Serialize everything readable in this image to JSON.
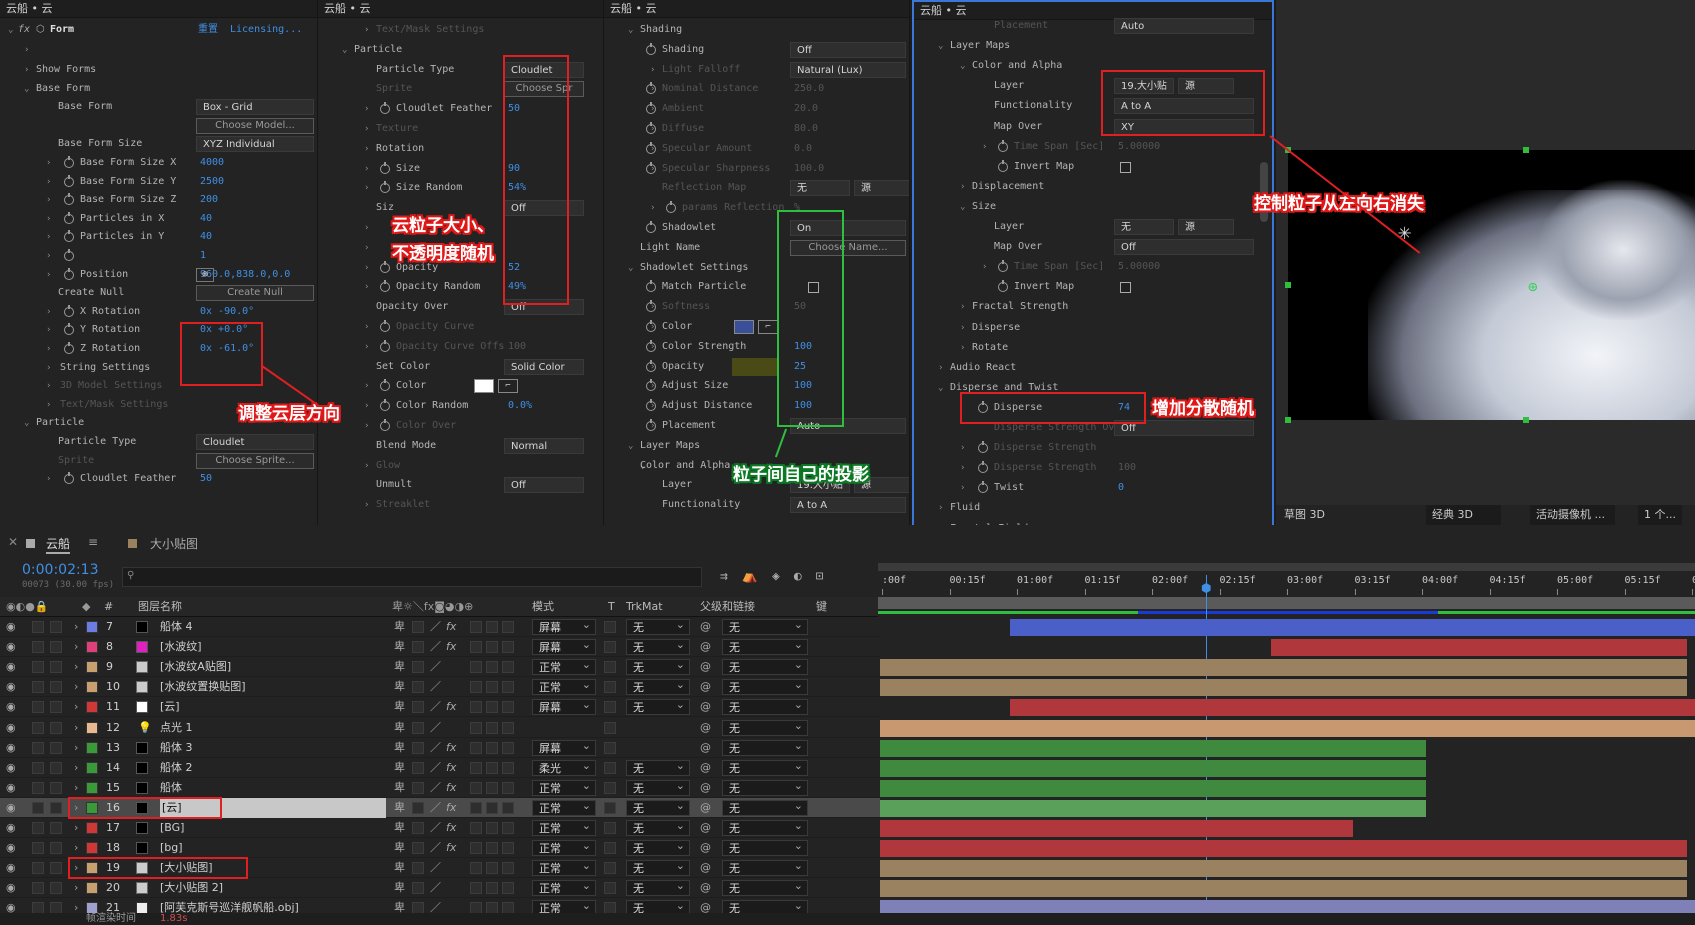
{
  "colors": {
    "accent": "#3f8fe5",
    "annotation_red": "#e02020",
    "annotation_green": "#2fbf3f",
    "selected_panel_border": "#3a78d8"
  },
  "panel1": {
    "title": "云船 • 云",
    "fx_label": "fx",
    "effect_name": "Form",
    "reset": "重置",
    "licensing": "Licensing...",
    "rows": [
      {
        "label": "Show Forms"
      },
      {
        "label": "Base Form"
      },
      {
        "label": "Base Form",
        "dd": "Box - Grid"
      },
      {
        "label": "",
        "btn": "Choose Model..."
      },
      {
        "label": "Base Form Size",
        "dd": "XYZ Individual"
      },
      {
        "label": "Base Form Size X",
        "val": "4000"
      },
      {
        "label": "Base Form Size Y",
        "val": "2500"
      },
      {
        "label": "Base Form Size Z",
        "val": "200"
      },
      {
        "label": "Particles in X",
        "val": "40"
      },
      {
        "label": "Particles in Y",
        "val": "40"
      },
      {
        "label": "",
        "val": "1"
      },
      {
        "label": "Position",
        "val": "960.0,838.0,0.0"
      },
      {
        "label": "Create Null",
        "btn": "Create Null"
      },
      {
        "label": "X Rotation",
        "val": "0x -90.0°"
      },
      {
        "label": "Y Rotation",
        "val": "0x +0.0°"
      },
      {
        "label": "Z Rotation",
        "val": "0x -61.0°"
      },
      {
        "label": "String Settings"
      },
      {
        "label": "3D Model Settings"
      },
      {
        "label": "Text/Mask Settings"
      },
      {
        "label": "Particle"
      },
      {
        "label": "Particle Type",
        "dd": "Cloudlet"
      },
      {
        "label": "Sprite",
        "btn": "Choose Sprite..."
      },
      {
        "label": "Cloudlet Feather",
        "val": "50"
      }
    ]
  },
  "panel2": {
    "title": "云船 • 云",
    "rows": [
      {
        "label": "Text/Mask Settings"
      },
      {
        "label": "Particle"
      },
      {
        "label": "Particle Type",
        "dd": "Cloudlet"
      },
      {
        "label": "Sprite",
        "btn": "Choose Spr"
      },
      {
        "label": "Cloudlet Feather",
        "val": "50"
      },
      {
        "label": "Texture"
      },
      {
        "label": "Rotation"
      },
      {
        "label": "Size",
        "val": "90"
      },
      {
        "label": "Size Random",
        "val": "54%"
      },
      {
        "label": "Siz",
        "dd": "Off"
      },
      {
        "label": "",
        "val": ""
      },
      {
        "label": "",
        "val": ""
      },
      {
        "label": "Opacity",
        "val": "52"
      },
      {
        "label": "Opacity Random",
        "val": "49%"
      },
      {
        "label": "Opacity Over",
        "dd": "Off"
      },
      {
        "label": "Opacity Curve"
      },
      {
        "label": "Opacity Curve Offs",
        "val": "100"
      },
      {
        "label": "Set Color",
        "dd": "Solid Color"
      },
      {
        "label": "Color"
      },
      {
        "label": "Color Random",
        "val": "0.0%"
      },
      {
        "label": "Color Over"
      },
      {
        "label": "Blend Mode",
        "dd": "Normal"
      },
      {
        "label": "Glow"
      },
      {
        "label": "Unmult",
        "dd": "Off"
      },
      {
        "label": "Streaklet"
      }
    ]
  },
  "panel3": {
    "title": "云船 • 云",
    "rows": [
      {
        "label": "Shading"
      },
      {
        "label": "Shading",
        "dd": "Off"
      },
      {
        "label": "Light Falloff",
        "dd": "Natural (Lux)"
      },
      {
        "label": "Nominal Distance",
        "val": "250.0"
      },
      {
        "label": "Ambient",
        "val": "20.0"
      },
      {
        "label": "Diffuse",
        "val": "80.0"
      },
      {
        "label": "Specular Amount",
        "val": "0.0"
      },
      {
        "label": "Specular Sharpness",
        "val": "100.0"
      },
      {
        "label": "Reflection Map",
        "dd": "无",
        "dd2": "源"
      },
      {
        "label": "params Reflection",
        "val": "%"
      },
      {
        "label": "Shadowlet",
        "dd": "On"
      },
      {
        "label": "Light Name",
        "btn": "Choose Name..."
      },
      {
        "label": "Shadowlet Settings"
      },
      {
        "label": "Match Particle"
      },
      {
        "label": "Softness",
        "val": "50"
      },
      {
        "label": "Color"
      },
      {
        "label": "Color Strength",
        "val": "100"
      },
      {
        "label": "Opacity",
        "val": "25"
      },
      {
        "label": "Adjust Size",
        "val": "100"
      },
      {
        "label": "Adjust Distance",
        "val": "100"
      },
      {
        "label": "Placement",
        "dd": "Auto"
      },
      {
        "label": "Layer Maps"
      },
      {
        "label": "Color and Alpha"
      },
      {
        "label": "Layer",
        "dd": "19.大小贴",
        "dd2": "源"
      },
      {
        "label": "Functionality",
        "dd": "A to A"
      }
    ]
  },
  "panel4": {
    "title": "云船 • 云",
    "rows": [
      {
        "label": "Placement",
        "dd": "Auto"
      },
      {
        "label": "Layer Maps"
      },
      {
        "label": "Color and Alpha"
      },
      {
        "label": "Layer",
        "dd": "19.大小贴",
        "dd2": "源"
      },
      {
        "label": "Functionality",
        "dd": "A to A"
      },
      {
        "label": "Map Over",
        "dd": "XY"
      },
      {
        "label": "Time Span [Sec]",
        "val": "5.00000"
      },
      {
        "label": "Invert Map"
      },
      {
        "label": "Displacement"
      },
      {
        "label": "Size"
      },
      {
        "label": "Layer",
        "dd": "无",
        "dd2": "源"
      },
      {
        "label": "Map Over",
        "dd": "Off"
      },
      {
        "label": "Time Span [Sec]",
        "val": "5.00000"
      },
      {
        "label": "Invert Map"
      },
      {
        "label": "Fractal Strength"
      },
      {
        "label": "Disperse"
      },
      {
        "label": "Rotate"
      },
      {
        "label": "Audio React"
      },
      {
        "label": "Disperse and Twist"
      },
      {
        "label": "Disperse",
        "val": "74"
      },
      {
        "label": "Disperse Strength Over",
        "dd": "Off"
      },
      {
        "label": "Disperse Strength"
      },
      {
        "label": "Disperse Strength",
        "val": "100"
      },
      {
        "label": "Twist",
        "val": "0"
      },
      {
        "label": "Fluid"
      },
      {
        "label": "Fractal Field"
      }
    ]
  },
  "viewer": {
    "toolbar": [
      "草图 3D",
      "经典 3D",
      "活动摄像机 ...",
      "1 个..."
    ]
  },
  "annotations": {
    "cloud_size": "云粒子大小、",
    "cloud_opacity": "不透明度随机",
    "adjust_direction": "调整云层方向",
    "shadow": "粒子间自己的投影",
    "disperse": "增加分散随机",
    "vanish": "控制粒子从左向右消失"
  },
  "timeline": {
    "tab_active": "云船",
    "tab_other": "大小贴图",
    "timecode": "0:00:02:13",
    "fps": "00073 (30.00 fps)",
    "search_placeholder": "",
    "headers": {
      "num": "#",
      "name": "图层名称",
      "mode": "模式",
      "t": "T",
      "trkmat": "TrkMat",
      "parent": "父级和链接",
      "keys": "键"
    },
    "ruler": [
      ":00f",
      "00:15f",
      "01:00f",
      "01:15f",
      "02:00f",
      "02:15f",
      "03:00f",
      "03:15f",
      "04:00f",
      "04:15f",
      "05:00f",
      "05:15f",
      "06:0"
    ],
    "footer": "帧渲染时间",
    "footer_val": "1.83s",
    "layers": [
      {
        "num": "7",
        "color": "#6c7ce0",
        "swatch": "#000",
        "name": "船体 4",
        "mode": "屏幕",
        "trk": "无",
        "parent": "无",
        "fx": true,
        "bar": "#4a5fc8",
        "bs": 0.16,
        "be": 1.0
      },
      {
        "num": "8",
        "color": "#e0407a",
        "swatch": "#e020c0",
        "name": "[水波纹]",
        "mode": "屏幕",
        "trk": "无",
        "parent": "无",
        "fx": true,
        "bar": "#b0383c",
        "bs": 0.48,
        "be": 0.99
      },
      {
        "num": "9",
        "color": "#c8a070",
        "swatch": "img",
        "name": "[水波纹A贴图]",
        "mode": "正常",
        "trk": "无",
        "parent": "无",
        "fx": false,
        "bar": "#9a8260",
        "bs": 0.0,
        "be": 0.99
      },
      {
        "num": "10",
        "color": "#c8a070",
        "swatch": "img",
        "name": "[水波纹置换贴图]",
        "mode": "正常",
        "trk": "无",
        "parent": "无",
        "fx": false,
        "bar": "#9a8260",
        "bs": 0.0,
        "be": 0.99
      },
      {
        "num": "11",
        "color": "#d03838",
        "swatch": "#fff",
        "name": "[云]",
        "mode": "屏幕",
        "trk": "无",
        "parent": "无",
        "fx": true,
        "bar": "#b0383c",
        "bs": 0.16,
        "be": 1.0
      },
      {
        "num": "12",
        "color": "#e8b890",
        "swatch": "light",
        "name": "点光 1",
        "mode": "",
        "trk": "",
        "parent": "无",
        "fx": false,
        "bar": "#c89870",
        "bs": 0.0,
        "be": 1.0
      },
      {
        "num": "13",
        "color": "#3a9a3a",
        "swatch": "#000",
        "name": "船体 3",
        "mode": "屏幕",
        "trk": "",
        "parent": "无",
        "fx": true,
        "bar": "#3f8a3f",
        "bs": 0.0,
        "be": 0.67
      },
      {
        "num": "14",
        "color": "#3a9a3a",
        "swatch": "#000",
        "name": "船体 2",
        "mode": "柔光",
        "trk": "无",
        "parent": "无",
        "fx": true,
        "bar": "#3f8a3f",
        "bs": 0.0,
        "be": 0.67
      },
      {
        "num": "15",
        "color": "#3a9a3a",
        "swatch": "#000",
        "name": "船体",
        "mode": "正常",
        "trk": "无",
        "parent": "无",
        "fx": true,
        "bar": "#3f8a3f",
        "bs": 0.0,
        "be": 0.67
      },
      {
        "num": "16",
        "color": "#3a9a3a",
        "swatch": "#000",
        "name": "[云]",
        "mode": "正常",
        "trk": "无",
        "parent": "无",
        "fx": true,
        "bar": "#5aa05a",
        "bs": 0.0,
        "be": 0.67,
        "selected": true
      },
      {
        "num": "17",
        "color": "#d03838",
        "swatch": "#000",
        "name": "[BG]",
        "mode": "正常",
        "trk": "无",
        "parent": "无",
        "fx": true,
        "bar": "#b0383c",
        "bs": 0.0,
        "be": 0.58
      },
      {
        "num": "18",
        "color": "#d03838",
        "swatch": "#000",
        "name": "[bg]",
        "mode": "正常",
        "trk": "无",
        "parent": "无",
        "fx": true,
        "bar": "#b0383c",
        "bs": 0.0,
        "be": 0.99
      },
      {
        "num": "19",
        "color": "#c8a070",
        "swatch": "img",
        "name": "[大小贴图]",
        "mode": "正常",
        "trk": "无",
        "parent": "无",
        "fx": false,
        "bar": "#9a8260",
        "bs": 0.0,
        "be": 0.99
      },
      {
        "num": "20",
        "color": "#c8a070",
        "swatch": "img",
        "name": "[大小贴图 2]",
        "mode": "正常",
        "trk": "无",
        "parent": "无",
        "fx": false,
        "bar": "#9a8260",
        "bs": 0.0,
        "be": 0.99
      },
      {
        "num": "21",
        "color": "#a0a0d0",
        "swatch": "file",
        "name": "[阿芙克斯号巡洋舰帆船.obj]",
        "mode": "正常",
        "trk": "无",
        "parent": "无",
        "fx": false,
        "bar": "#8080b8",
        "bs": 0.0,
        "be": 1.0
      }
    ]
  }
}
